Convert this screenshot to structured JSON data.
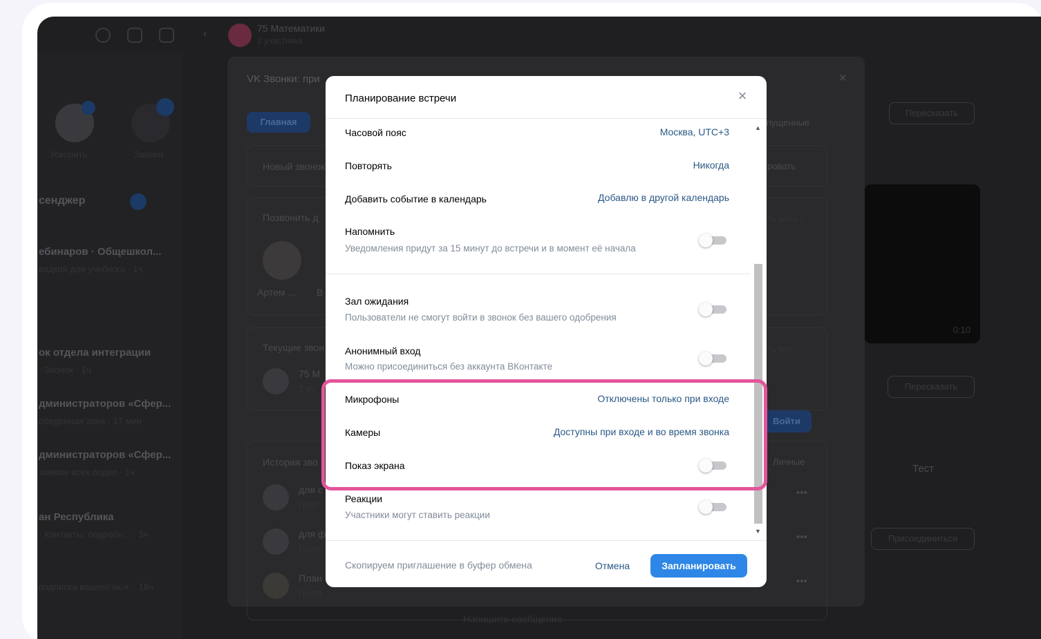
{
  "background": {
    "chat_title": "75 Математики",
    "chat_subtitle": "2 участника",
    "sidebar_labels": [
      "Ускорить",
      "Звонки"
    ],
    "sidebar_heading": "сенджер",
    "sidebar_items": [
      {
        "title": "ебинаров · Общешкол...",
        "sub": "вадкий для учебного · 1ч"
      },
      {
        "title": "ок отдела интеграции",
        "sub": "· Звонок · 1ч"
      },
      {
        "title": "дминистраторов «Сфер...",
        "sub": "обеденная зона · 17 мин"
      },
      {
        "title": "дминистраторов «Сфер...",
        "sub": "заявим всех подел · 1ч"
      },
      {
        "title": "ан Республика",
        "sub": "· Контакты: подробн... · 3ч"
      }
    ],
    "sidebar_footer": "подписка вашего ак.ч. · 18ч",
    "composer_placeholder": "Напишите сообщение",
    "right_labels": [
      "Пересказать",
      "Пересказать",
      "Тест",
      "Присоединиться"
    ],
    "right_video_time": "0:10",
    "dialog": {
      "title": "VK Звонки: при",
      "tab_main": "Главная",
      "tab_missed": "пущенные",
      "new_call": "Новый звонок",
      "schedule": "ровать",
      "call_friends": "Позвонить д",
      "show_all": "ть всех ›",
      "contact_name": "Артем ...",
      "contact_letter": "В",
      "current_calls": "Текущие звон",
      "show_all_2": "ть все ›",
      "current_item": "75 М",
      "current_item_sub": "2 уч",
      "enter": "Войти",
      "history": "История зво",
      "personal": "Личные",
      "history_items": [
        {
          "title": "для с",
          "sub": "Груп"
        },
        {
          "title": "для ф",
          "sub": "Групп"
        },
        {
          "title": "План",
          "sub": "Групп"
        }
      ]
    }
  },
  "modal": {
    "title": "Планирование встречи",
    "rows": {
      "timezone": {
        "label": "Часовой пояс",
        "value": "Москва, UTC+3"
      },
      "repeat": {
        "label": "Повторять",
        "value": "Никогда"
      },
      "calendar": {
        "label": "Добавить событие в календарь",
        "value": "Добавлю в другой календарь"
      },
      "remind": {
        "label": "Напомнить",
        "sub": "Уведомления придут за 15 минут до встречи и в момент её начала",
        "enabled": false
      },
      "waiting_room": {
        "label": "Зал ожидания",
        "sub": "Пользователи не смогут войти в звонок без вашего одобрения",
        "enabled": false
      },
      "anonymous": {
        "label": "Анонимный вход",
        "sub": "Можно присоединиться без аккаунта ВКонтакте",
        "enabled": false
      },
      "microphones": {
        "label": "Микрофоны",
        "value": "Отключены только при входе"
      },
      "cameras": {
        "label": "Камеры",
        "value": "Доступны при входе и во время звонка"
      },
      "screen_share": {
        "label": "Показ экрана",
        "enabled": false
      },
      "reactions": {
        "label": "Реакции",
        "sub": "Участники могут ставить реакции",
        "enabled": false
      }
    },
    "footer": {
      "copy_invite": "Скопируем приглашение в буфер обмена",
      "cancel": "Отмена",
      "schedule": "Запланировать"
    }
  },
  "colors": {
    "accent": "#2e87e6",
    "link": "#2a5885",
    "highlight": "#e3559b"
  }
}
